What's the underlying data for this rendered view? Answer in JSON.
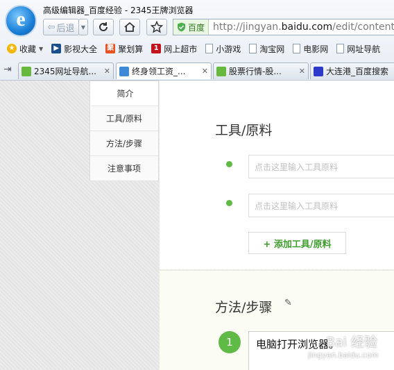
{
  "window": {
    "title": "高级编辑器_百度经验 - 2345王牌浏览器"
  },
  "toolbar": {
    "back_label": "后退",
    "url_badge": "百度",
    "url_prefix": "http://jingyan.",
    "url_domain": "baidu.com",
    "url_path": "/edit/content"
  },
  "bookmarks": [
    {
      "label": "收藏",
      "icon": "star-add-icon"
    },
    {
      "label": "影视大全",
      "icon": "film-icon"
    },
    {
      "label": "聚划算",
      "icon": "juhuasuan-icon"
    },
    {
      "label": "网上超市",
      "icon": "supermarket-icon"
    },
    {
      "label": "小游戏",
      "icon": "page-icon"
    },
    {
      "label": "淘宝网",
      "icon": "page-icon"
    },
    {
      "label": "电影网",
      "icon": "page-icon"
    },
    {
      "label": "网址导航",
      "icon": "page-icon"
    }
  ],
  "tabs": [
    {
      "label": "2345网址导航...",
      "icon": "home-icon"
    },
    {
      "label": "终身领工资_...",
      "icon": "baidu-jingyan-icon"
    },
    {
      "label": "股票行情-股...",
      "icon": "home-icon"
    },
    {
      "label": "大连港_百度搜索",
      "icon": "baidu-paw-icon"
    }
  ],
  "side_nav": {
    "items": [
      "简介",
      "工具/原料",
      "方法/步骤",
      "注意事项"
    ],
    "active": "简介"
  },
  "tools_section": {
    "title": "工具/原料",
    "input_placeholder": "点击这里输入工具原料",
    "add_button": "+ 添加工具/原料"
  },
  "steps_section": {
    "title": "方法/步骤",
    "steps": [
      {
        "number": "1",
        "text": "电脑打开浏览器。"
      }
    ]
  },
  "watermark": {
    "text": "Bai 经验",
    "url": "jingyan.baidu.com"
  },
  "colors": {
    "accent_green": "#5fba46",
    "link_green": "#3f9c2e"
  }
}
